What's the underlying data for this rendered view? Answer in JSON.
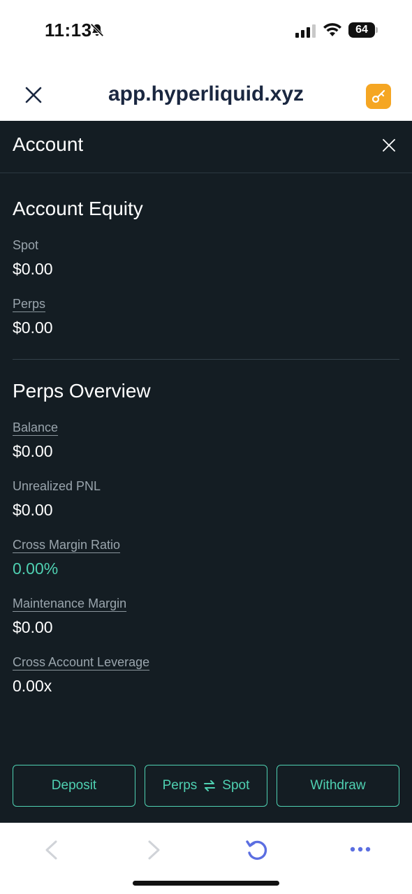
{
  "status_bar": {
    "time": "11:13",
    "battery": "64",
    "icons": [
      "bell-muted-icon",
      "signal-icon",
      "wifi-icon",
      "battery-icon"
    ]
  },
  "browser": {
    "url": "app.hyperliquid.xyz",
    "icons": [
      "close-x-icon",
      "key-icon"
    ],
    "accent": "#f5a623"
  },
  "panel": {
    "title": "Account",
    "background": "#141d23",
    "accent": "#4fd1b2"
  },
  "equity": {
    "title": "Account Equity",
    "spot_label": "Spot",
    "spot_value": "$0.00",
    "perps_label": "Perps",
    "perps_value": "$0.00"
  },
  "overview": {
    "title": "Perps Overview",
    "balance_label": "Balance",
    "balance_value": "$0.00",
    "upnl_label": "Unrealized PNL",
    "upnl_value": "$0.00",
    "cmr_label": "Cross Margin Ratio",
    "cmr_value": "0.00%",
    "mm_label": "Maintenance Margin",
    "mm_value": "$0.00",
    "cal_label": "Cross Account Leverage",
    "cal_value": "0.00x"
  },
  "actions": {
    "deposit": "Deposit",
    "transfer_left": "Perps",
    "transfer_right": "Spot",
    "withdraw": "Withdraw"
  },
  "toolbar": {
    "icons": [
      "back-icon",
      "forward-icon",
      "reload-icon",
      "more-icon"
    ]
  }
}
